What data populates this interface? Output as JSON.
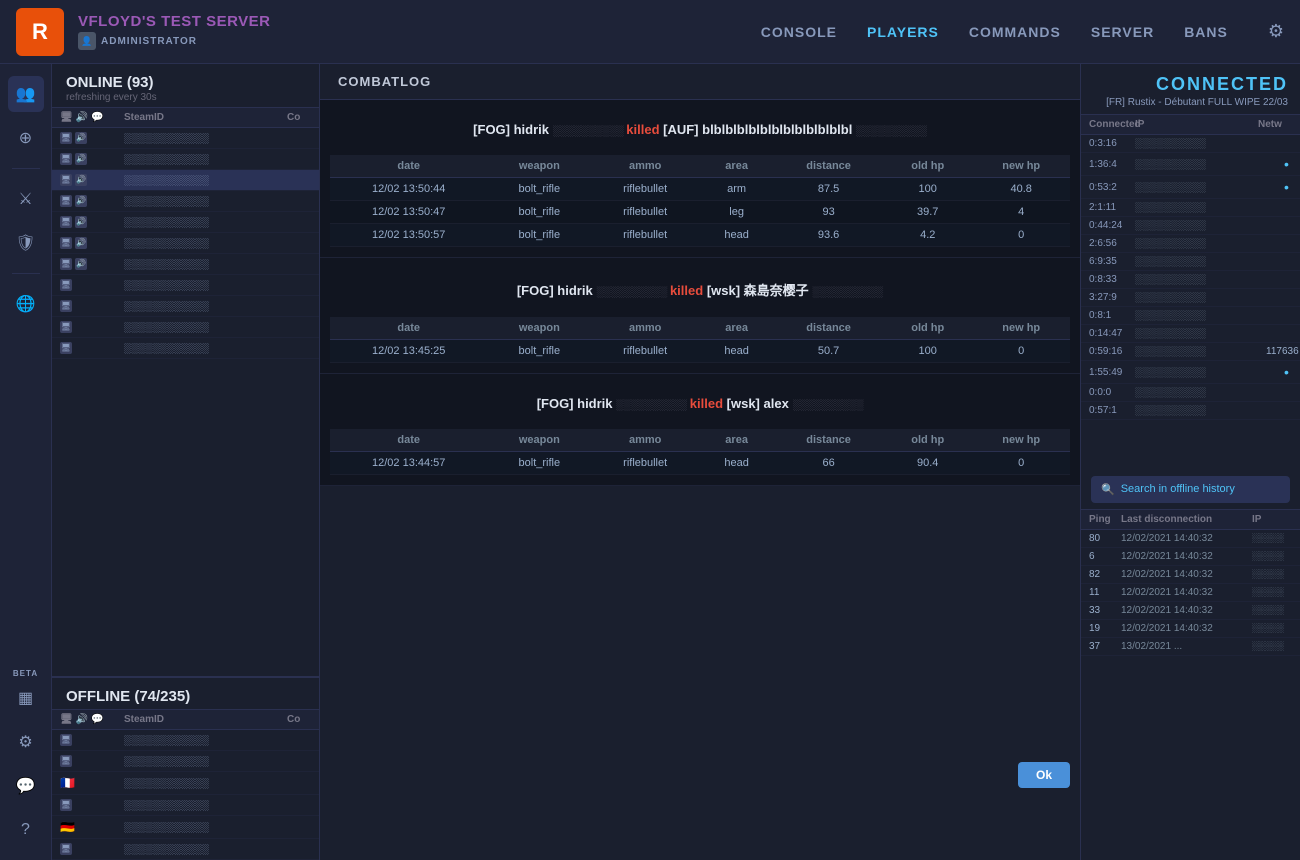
{
  "topnav": {
    "logo": "R",
    "server_name": "VFLOYD'S TEST SERVER",
    "admin_label": "ADMINISTRATOR",
    "links": [
      {
        "id": "console",
        "label": "CONSOLE",
        "active": false
      },
      {
        "id": "players",
        "label": "PLAYERS",
        "active": true
      },
      {
        "id": "commands",
        "label": "COMMANDS",
        "active": false
      },
      {
        "id": "server",
        "label": "SERVER",
        "active": false
      },
      {
        "id": "bans",
        "label": "BANS",
        "active": false
      }
    ]
  },
  "online_section": {
    "title": "ONLINE (93)",
    "subtitle": "refreshing every 30s",
    "table_headers": [
      "SteamID",
      "Co"
    ],
    "players": [
      {
        "steam": "░░░░░░░░░░░░░░",
        "co": ""
      },
      {
        "steam": "░░░░░░░░░░░░░░",
        "co": ""
      },
      {
        "steam": "░░░░░░░░░░░░░░",
        "co": ""
      },
      {
        "steam": "░░░░░░░░░░░░░░",
        "co": ""
      },
      {
        "steam": "░░░░░░░░░░░░░░",
        "co": ""
      },
      {
        "steam": "░░░░░░░░░░░░░░",
        "co": ""
      },
      {
        "steam": "░░░░░░░░░░░░░░",
        "co": ""
      },
      {
        "steam": "░░░░░░░░░░░░░░",
        "co": ""
      },
      {
        "steam": "░░░░░░░░░░░░░░",
        "co": ""
      },
      {
        "steam": "░░░░░░░░░░░░░░",
        "co": ""
      },
      {
        "steam": "░░░░░░░░░░░░░░",
        "co": ""
      }
    ]
  },
  "offline_section": {
    "title": "OFFLINE (74/235)",
    "table_headers": [
      "SteamID",
      "Co"
    ],
    "players": [
      {
        "steam": "░░░░░░░░░░░░░░",
        "co": ""
      },
      {
        "steam": "░░░░░░░░░░░░░░",
        "co": ""
      },
      {
        "steam": "░░░░░░░░░░░░░░",
        "co": ""
      },
      {
        "steam": "░░░░░░░░░░░░░░",
        "co": ""
      },
      {
        "steam": "░░░░░░░░░░░░░░",
        "co": ""
      },
      {
        "steam": "░░░░░░░░░░░░░░",
        "co": ""
      }
    ]
  },
  "combatlog": {
    "header": "COMBATLOG",
    "kills": [
      {
        "attacker": "[FOG] hidrik",
        "attacker_extra": "░░░░░░░░░░░░░░",
        "action": "killed",
        "victim": "[AUF] blblblblblblblblblblblblbl",
        "victim_extra": "░░░░░░░░░░░░░░",
        "table_headers": [
          "date",
          "weapon",
          "ammo",
          "area",
          "distance",
          "old hp",
          "new hp"
        ],
        "rows": [
          {
            "date": "12/02 13:50:44",
            "weapon": "bolt_rifle",
            "ammo": "riflebullet",
            "area": "arm",
            "distance": "87.5",
            "old_hp": "100",
            "new_hp": "40.8"
          },
          {
            "date": "12/02 13:50:47",
            "weapon": "bolt_rifle",
            "ammo": "riflebullet",
            "area": "leg",
            "distance": "93",
            "old_hp": "39.7",
            "new_hp": "4"
          },
          {
            "date": "12/02 13:50:57",
            "weapon": "bolt_rifle",
            "ammo": "riflebullet",
            "area": "head",
            "distance": "93.6",
            "old_hp": "4.2",
            "new_hp": "0"
          }
        ]
      },
      {
        "attacker": "[FOG] hidrik",
        "attacker_extra": "░░░░░░░░░░░░░░",
        "action": "killed",
        "victim": "[wsk] 森島奈樱子",
        "victim_extra": "░░░░░░░░░░░░░░",
        "table_headers": [
          "date",
          "weapon",
          "ammo",
          "area",
          "distance",
          "old hp",
          "new hp"
        ],
        "rows": [
          {
            "date": "12/02 13:45:25",
            "weapon": "bolt_rifle",
            "ammo": "riflebullet",
            "area": "head",
            "distance": "50.7",
            "old_hp": "100",
            "new_hp": "0"
          }
        ]
      },
      {
        "attacker": "[FOG] hidrik",
        "attacker_extra": "░░░░░░░░░░░░░░",
        "action": "killed",
        "victim": "[wsk] alex",
        "victim_extra": "░░░░░░░░░░░░░░",
        "table_headers": [
          "date",
          "weapon",
          "ammo",
          "area",
          "distance",
          "old hp",
          "new hp"
        ],
        "rows": [
          {
            "date": "12/02 13:44:57",
            "weapon": "bolt_rifle",
            "ammo": "riflebullet",
            "area": "head",
            "distance": "66",
            "old_hp": "90.4",
            "new_hp": "0"
          }
        ]
      }
    ],
    "ok_label": "Ok"
  },
  "right_panel": {
    "connected_title": "CONNECTED",
    "connected_subtitle": "[FR] Rustix - Débutant FULL WIPE 22/03",
    "table_headers": [
      "Connected",
      "IP",
      "Netw"
    ],
    "rows": [
      {
        "connected": "0:3:16",
        "ip": "░░░░░░░░░░",
        "net": ""
      },
      {
        "connected": "1:36:4",
        "ip": "░░░░░░░░░░",
        "net": "•"
      },
      {
        "connected": "0:53:2",
        "ip": "░░░░░░░░░░",
        "net": "•"
      },
      {
        "connected": "2:1:11",
        "ip": "░░░░░░░░░░",
        "net": ""
      },
      {
        "connected": "0:44:24",
        "ip": "░░░░░░░░░░",
        "net": ""
      },
      {
        "connected": "2:6:56",
        "ip": "░░░░░░░░░░",
        "net": ""
      },
      {
        "connected": "6:9:35",
        "ip": "░░░░░░░░░░",
        "net": ""
      },
      {
        "connected": "0:8:33",
        "ip": "░░░░░░░░░░",
        "net": ""
      },
      {
        "connected": "3:27:9",
        "ip": "░░░░░░░░░░",
        "net": ""
      },
      {
        "connected": "0:8:1",
        "ip": "░░░░░░░░░░",
        "net": ""
      },
      {
        "connected": "0:14:47",
        "ip": "░░░░░░░░░░",
        "net": ""
      },
      {
        "connected": "0:59:16",
        "ip": "░░░░░░░░░░",
        "net": "117636"
      },
      {
        "connected": "1:55:49",
        "ip": "░░░░░░░░░░",
        "net": "•"
      },
      {
        "connected": "0:0:0",
        "ip": "░░░░░░░░░░",
        "net": ""
      },
      {
        "connected": "0:57:1",
        "ip": "░░░░░░░░░░",
        "net": ""
      }
    ],
    "search_offline_label": "Search in offline history",
    "offline_headers": [
      "Ping",
      "Last disconnection",
      "IP"
    ],
    "offline_rows": [
      {
        "ping": "80",
        "disc": "12/02/2021 14:40:32",
        "ip": "░░░░░"
      },
      {
        "ping": "6",
        "disc": "12/02/2021 14:40:32",
        "ip": "░░░░░"
      },
      {
        "ping": "82",
        "disc": "12/02/2021 14:40:32",
        "ip": "░░░░░"
      },
      {
        "ping": "11",
        "disc": "12/02/2021 14:40:32",
        "ip": "░░░░░"
      },
      {
        "ping": "33",
        "disc": "12/02/2021 14:40:32",
        "ip": "░░░░░"
      },
      {
        "ping": "19",
        "disc": "12/02/2021 14:40:32",
        "ip": "░░░░░"
      },
      {
        "ping": "37",
        "disc": "13/02/2021 ...",
        "ip": "░░░░░"
      }
    ]
  },
  "sidebar": {
    "icons": [
      {
        "name": "users-icon",
        "glyph": "👥"
      },
      {
        "name": "crosshair-icon",
        "glyph": "⊕"
      },
      {
        "name": "knife-icon",
        "glyph": "⚔"
      },
      {
        "name": "shield-icon",
        "glyph": "🛡"
      },
      {
        "name": "globe-icon",
        "glyph": "🌐"
      },
      {
        "name": "grid-icon",
        "glyph": "▦"
      },
      {
        "name": "gear-icon",
        "glyph": "⚙"
      },
      {
        "name": "discord-icon",
        "glyph": "💬"
      },
      {
        "name": "help-icon",
        "glyph": "?"
      }
    ],
    "beta_label": "BETA"
  }
}
